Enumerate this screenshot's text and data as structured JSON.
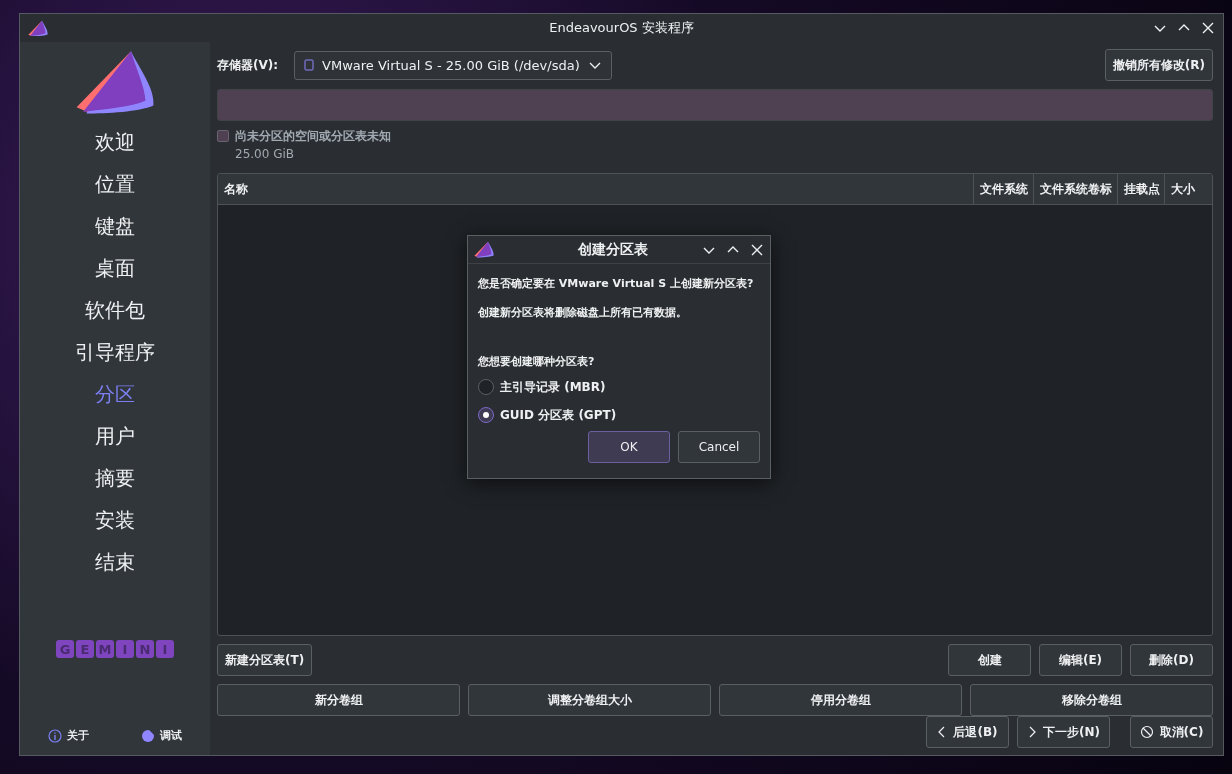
{
  "window": {
    "title": "EndeavourOS 安装程序"
  },
  "sidebar": {
    "items": [
      {
        "label": "欢迎",
        "selected": false
      },
      {
        "label": "位置",
        "selected": false
      },
      {
        "label": "键盘",
        "selected": false
      },
      {
        "label": "桌面",
        "selected": false
      },
      {
        "label": "软件包",
        "selected": false
      },
      {
        "label": "引导程序",
        "selected": false
      },
      {
        "label": "分区",
        "selected": true
      },
      {
        "label": "用户",
        "selected": false
      },
      {
        "label": "摘要",
        "selected": false
      },
      {
        "label": "安装",
        "selected": false
      },
      {
        "label": "结束",
        "selected": false
      }
    ],
    "logo_letters": [
      "G",
      "E",
      "M",
      "I",
      "N",
      "I"
    ],
    "about": "关于",
    "debug": "调试"
  },
  "storage": {
    "label": "存储器(V):",
    "device": "VMware Virtual S - 25.00 GiB (/dev/sda)",
    "revert_button": "撤销所有修改(R)"
  },
  "legend": [
    {
      "label": "尚未分区的空间或分区表未知",
      "size": "25.00 GiB",
      "color": "#4f4152"
    }
  ],
  "table": {
    "columns": [
      "名称",
      "文件系统",
      "文件系统卷标",
      "挂载点",
      "大小"
    ]
  },
  "actions": {
    "new_table": "新建分区表(T)",
    "right": [
      "创建",
      "编辑(E)",
      "删除(D)"
    ],
    "volume_groups": [
      "新分卷组",
      "调整分卷组大小",
      "停用分卷组",
      "移除分卷组"
    ]
  },
  "navigation": {
    "back": "后退(B)",
    "next": "下一步(N)",
    "cancel": "取消(C)"
  },
  "dialog": {
    "title": "创建分区表",
    "message": "您是否确定要在 VMware Virtual S 上创建新分区表?",
    "warning": "创建新分区表将删除磁盘上所有已有数据。",
    "question": "您想要创建哪种分区表?",
    "options": [
      {
        "label": "主引导记录 (MBR)",
        "selected": false
      },
      {
        "label": "GUID 分区表 (GPT)",
        "selected": true
      }
    ],
    "buttons": [
      "OK",
      "Cancel"
    ]
  }
}
